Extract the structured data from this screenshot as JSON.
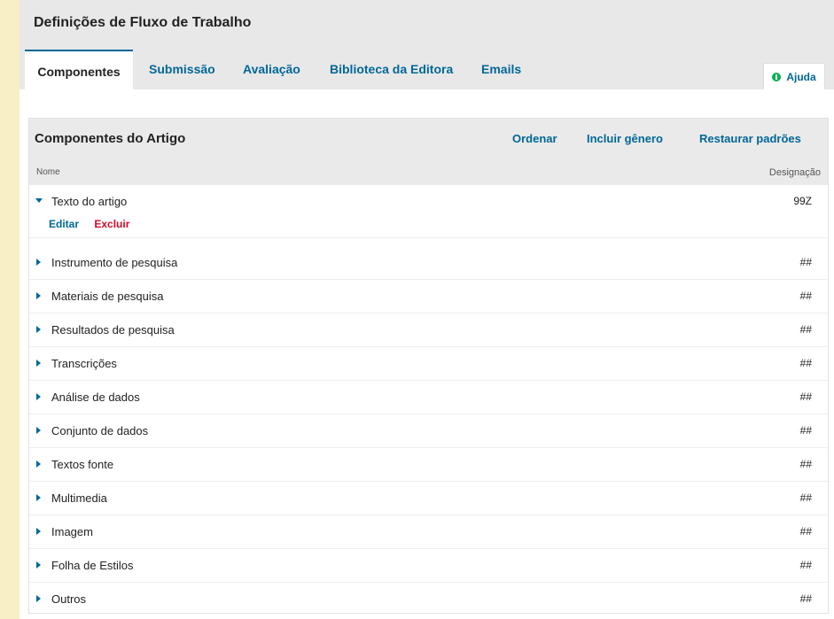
{
  "page": {
    "title": "Definições de Fluxo de Trabalho"
  },
  "tabs": [
    {
      "label": "Componentes",
      "active": true
    },
    {
      "label": "Submissão"
    },
    {
      "label": "Avaliação"
    },
    {
      "label": "Biblioteca da Editora"
    },
    {
      "label": "Emails"
    }
  ],
  "help": {
    "label": "Ajuda",
    "icon": "info-icon"
  },
  "panel": {
    "title": "Componentes do Artigo",
    "actions": {
      "order": "Ordenar",
      "add_genre": "Incluir gênero",
      "restore": "Restaurar padrões"
    },
    "columns": {
      "name": "Nome",
      "designation": "Designação"
    },
    "row_actions": {
      "edit": "Editar",
      "delete": "Excluir"
    },
    "rows": [
      {
        "label": "Texto do artigo",
        "designation": "99Z",
        "expanded": true
      },
      {
        "label": "Instrumento de pesquisa",
        "designation": "##"
      },
      {
        "label": "Materiais de pesquisa",
        "designation": "##"
      },
      {
        "label": "Resultados de pesquisa",
        "designation": "##"
      },
      {
        "label": "Transcrições",
        "designation": "##"
      },
      {
        "label": "Análise de dados",
        "designation": "##"
      },
      {
        "label": "Conjunto de dados",
        "designation": "##"
      },
      {
        "label": "Textos fonte",
        "designation": "##"
      },
      {
        "label": "Multimedia",
        "designation": "##"
      },
      {
        "label": "Imagem",
        "designation": "##"
      },
      {
        "label": "Folha de Estilos",
        "designation": "##"
      },
      {
        "label": "Outros",
        "designation": "##"
      }
    ]
  },
  "colors": {
    "link": "#006798",
    "danger": "#d00a2c",
    "help_icon": "#00b24e",
    "page_bg": "#f8efc6"
  }
}
